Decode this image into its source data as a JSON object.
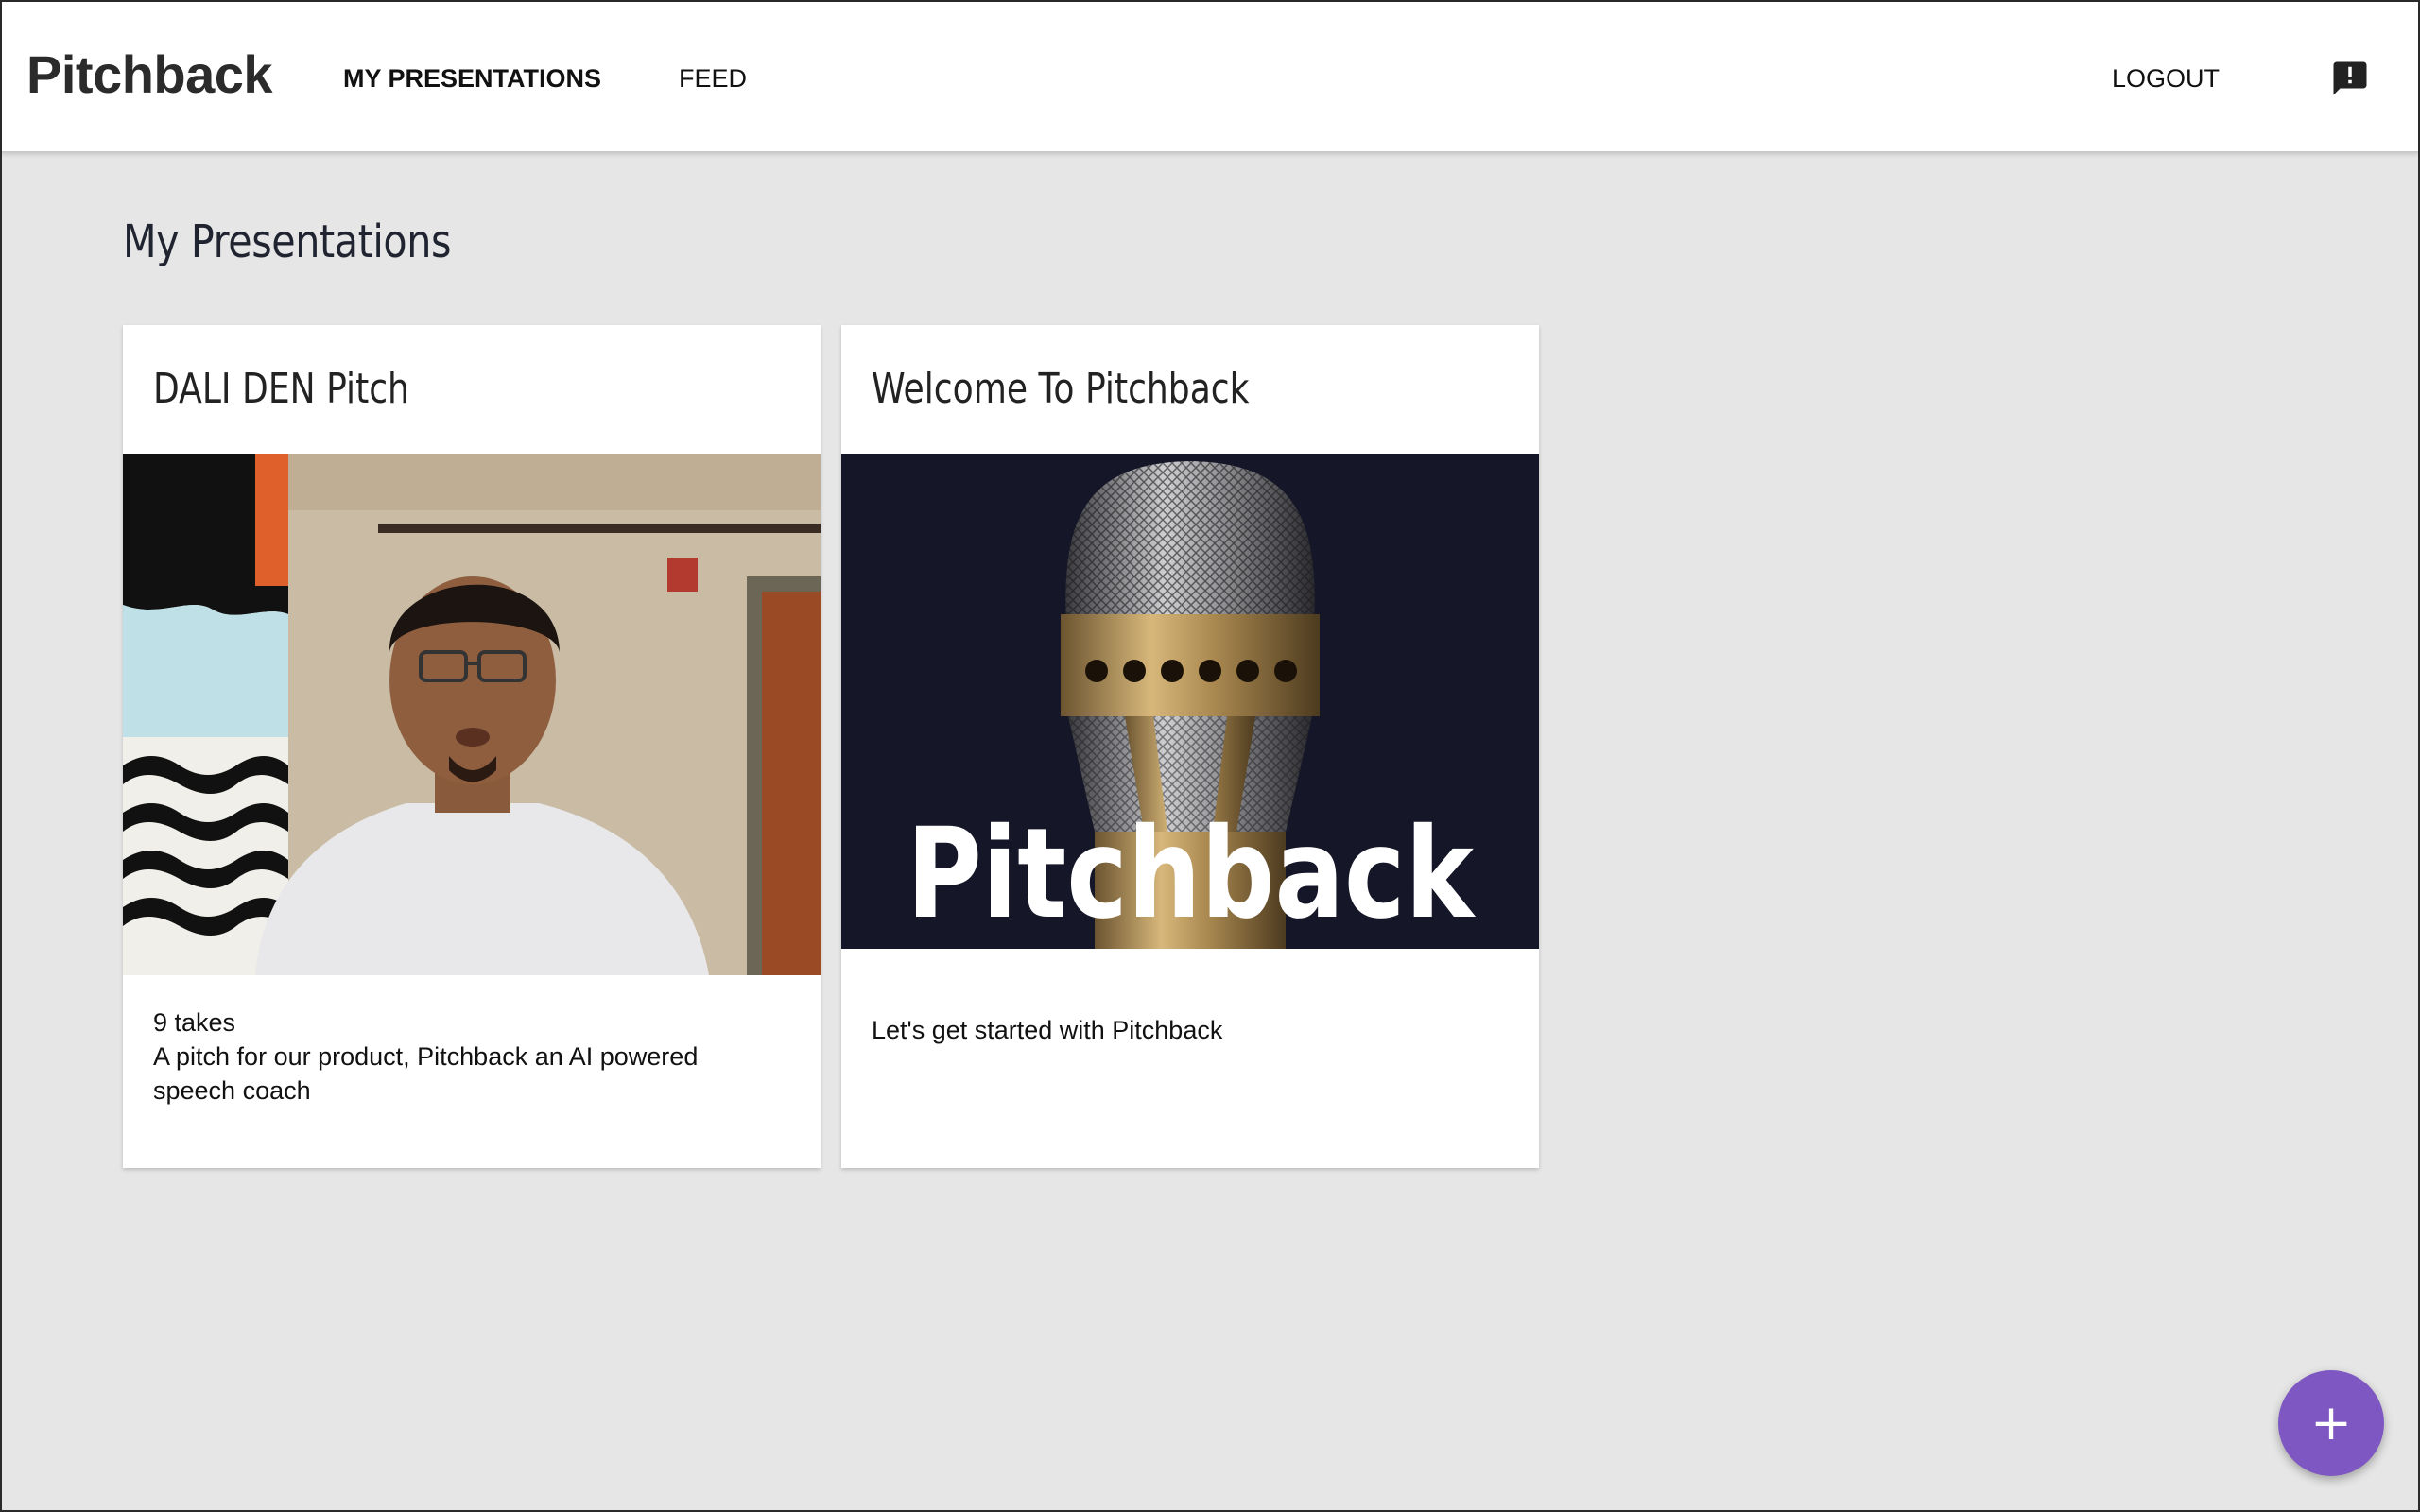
{
  "navbar": {
    "brand": "Pitchback",
    "links": [
      {
        "label": "MY PRESENTATIONS"
      },
      {
        "label": "FEED"
      }
    ],
    "logout_label": "LOGOUT",
    "feedback_icon": "feedback-alert-icon"
  },
  "main": {
    "title": "My Presentations",
    "cards": [
      {
        "title": "DALI DEN Pitch",
        "takes": "9 takes",
        "description": "A pitch for our product, Pitchback an AI powered speech coach",
        "thumbnail": "presenter-video-thumbnail"
      },
      {
        "title": "Welcome To Pitchback",
        "description": "Let's get started with Pitchback",
        "thumbnail_text": "Pitchback",
        "thumbnail": "microphone-thumbnail"
      }
    ]
  },
  "fab": {
    "label": "+",
    "icon": "plus-icon"
  },
  "colors": {
    "background": "#e6e6e6",
    "navbar": "#ffffff",
    "fab": "#7e57c2",
    "card": "#ffffff"
  }
}
